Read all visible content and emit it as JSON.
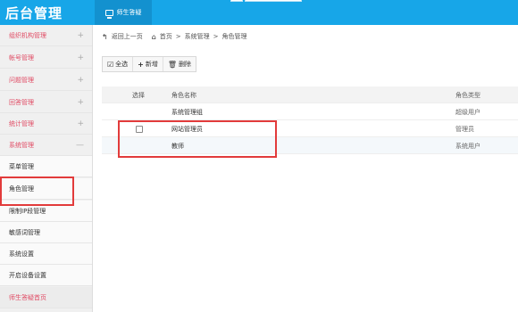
{
  "header": {
    "logo": "后台管理",
    "active_tab": "师生答疑"
  },
  "sidebar": {
    "items": [
      {
        "label": "组织机构管理",
        "sign": "+"
      },
      {
        "label": "帐号管理",
        "sign": "+"
      },
      {
        "label": "问题管理",
        "sign": "+"
      },
      {
        "label": "回答管理",
        "sign": "+"
      },
      {
        "label": "统计管理",
        "sign": "+"
      },
      {
        "label": "系统管理",
        "sign": "—"
      }
    ],
    "subitems": [
      "菜单管理",
      "角色管理",
      "限制IP段管理",
      "敏感词管理",
      "系统设置",
      "开启设备设置"
    ],
    "footer": "师生答疑首页"
  },
  "breadcrumb": {
    "back": "返回上一页",
    "home": "首页",
    "sep": ">",
    "level1": "系统管理",
    "current": "角色管理"
  },
  "toolbar": {
    "select_all": "全选",
    "add": "新增",
    "delete": "删除"
  },
  "table": {
    "headers": {
      "select": "选择",
      "name": "角色名称",
      "type": "角色类型"
    },
    "rows": [
      {
        "name": "系统管理组",
        "type": "超级用户"
      },
      {
        "name": "网站管理员",
        "type": "管理员"
      },
      {
        "name": "教师",
        "type": "系统用户"
      }
    ]
  },
  "colors": {
    "topbar": "#17a6e8",
    "accent_text": "#e04a63",
    "highlight": "#e23b3b"
  }
}
